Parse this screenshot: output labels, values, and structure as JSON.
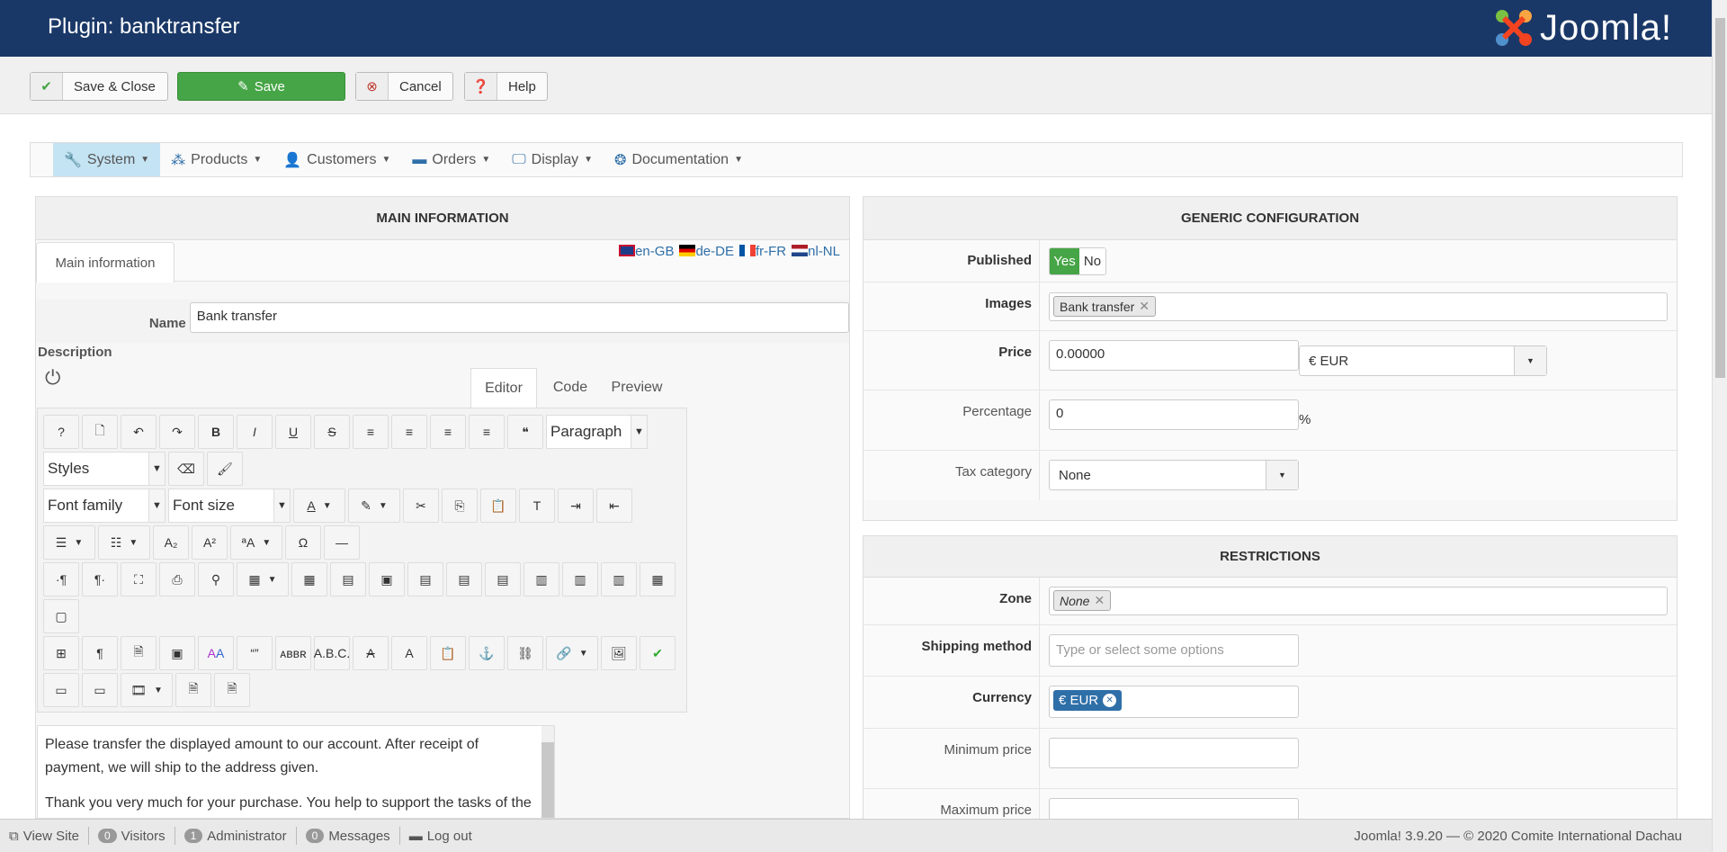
{
  "header": {
    "title": "Plugin: banktransfer",
    "logo_text": "Joomla!"
  },
  "toolbar": {
    "save_close": "Save & Close",
    "save": "Save",
    "cancel": "Cancel",
    "help": "Help"
  },
  "menu": [
    {
      "label": "System",
      "icon": "wrench-icon",
      "glyph": "🔧"
    },
    {
      "label": "Products",
      "icon": "cubes-icon",
      "glyph": "⁂"
    },
    {
      "label": "Customers",
      "icon": "user-icon",
      "glyph": "👤"
    },
    {
      "label": "Orders",
      "icon": "credit-card-icon",
      "glyph": "▬"
    },
    {
      "label": "Display",
      "icon": "monitor-icon",
      "glyph": "🖵"
    },
    {
      "label": "Documentation",
      "icon": "lifebuoy-icon",
      "glyph": "❂"
    }
  ],
  "main": {
    "heading": "MAIN INFORMATION",
    "tab": "Main information",
    "languages": [
      "en-GB",
      "de-DE",
      "fr-FR",
      "nl-NL"
    ],
    "name_label": "Name",
    "name_value": "Bank transfer",
    "description_label": "Description",
    "editor_tabs": [
      "Editor",
      "Code",
      "Preview"
    ],
    "editor_selects": {
      "paragraph": "Paragraph",
      "styles": "Styles",
      "font_family": "Font family",
      "font_size": "Font size"
    },
    "content": [
      "Please transfer the displayed amount to our account. After receipt of payment, we will ship to the address given.",
      "Thank you very much for your purchase. You help to support the tasks of the CID."
    ]
  },
  "generic": {
    "heading": "GENERIC CONFIGURATION",
    "published_label": "Published",
    "yes": "Yes",
    "no": "No",
    "images_label": "Images",
    "images_chip": "Bank transfer",
    "price_label": "Price",
    "price_value": "0.00000",
    "price_currency": "€ EUR",
    "percentage_label": "Percentage",
    "percentage_value": "0",
    "percent_sign": "%",
    "tax_label": "Tax category",
    "tax_value": "None"
  },
  "restrictions": {
    "heading": "RESTRICTIONS",
    "zone_label": "Zone",
    "zone_chip": "None",
    "shipping_label": "Shipping method",
    "shipping_placeholder": "Type or select some options",
    "currency_label": "Currency",
    "currency_chip": "€ EUR",
    "min_label": "Minimum price",
    "max_label": "Maximum price"
  },
  "footer": {
    "view_site": "View Site",
    "visitors_count": "0",
    "visitors": "Visitors",
    "admin_count": "1",
    "admin": "Administrator",
    "messages_count": "0",
    "messages": "Messages",
    "logout": "Log out",
    "version": "Joomla! 3.9.20 — © 2020 Comite International Dachau"
  },
  "colors": {
    "header": "#1a3867",
    "save": "#46a546",
    "chip_blue": "#2f6fa8"
  }
}
